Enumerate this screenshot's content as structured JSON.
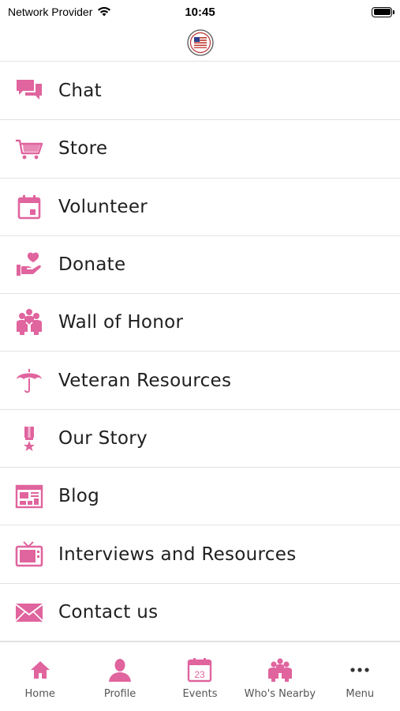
{
  "status_bar": {
    "carrier": "Network Provider",
    "time": "10:45",
    "wifi_icon": "wifi-icon",
    "battery_icon": "battery-icon"
  },
  "header": {
    "logo_icon": "organization-seal-logo"
  },
  "theme": {
    "accent": "#e0649e",
    "text": "#1f1f1f",
    "divider": "#e2e2e2",
    "tab_label": "#555555"
  },
  "menu": {
    "items": [
      {
        "label": "Chat",
        "icon": "chat-bubbles-icon"
      },
      {
        "label": "Store",
        "icon": "shopping-cart-icon"
      },
      {
        "label": "Volunteer",
        "icon": "calendar-icon"
      },
      {
        "label": "Donate",
        "icon": "heart-hand-icon"
      },
      {
        "label": "Wall of Honor",
        "icon": "people-group-icon"
      },
      {
        "label": "Veteran Resources",
        "icon": "umbrella-icon"
      },
      {
        "label": "Our Story",
        "icon": "medal-icon"
      },
      {
        "label": "Blog",
        "icon": "newspaper-icon"
      },
      {
        "label": "Interviews and Resources",
        "icon": "tv-icon"
      },
      {
        "label": "Contact us",
        "icon": "envelope-icon"
      }
    ]
  },
  "tabs": [
    {
      "label": "Home",
      "icon": "home-icon"
    },
    {
      "label": "Profile",
      "icon": "profile-icon"
    },
    {
      "label": "Events",
      "icon": "calendar-date-icon",
      "date_text": "23"
    },
    {
      "label": "Who's Nearby",
      "icon": "people-group-icon"
    },
    {
      "label": "Menu",
      "icon": "more-dots-icon"
    }
  ]
}
